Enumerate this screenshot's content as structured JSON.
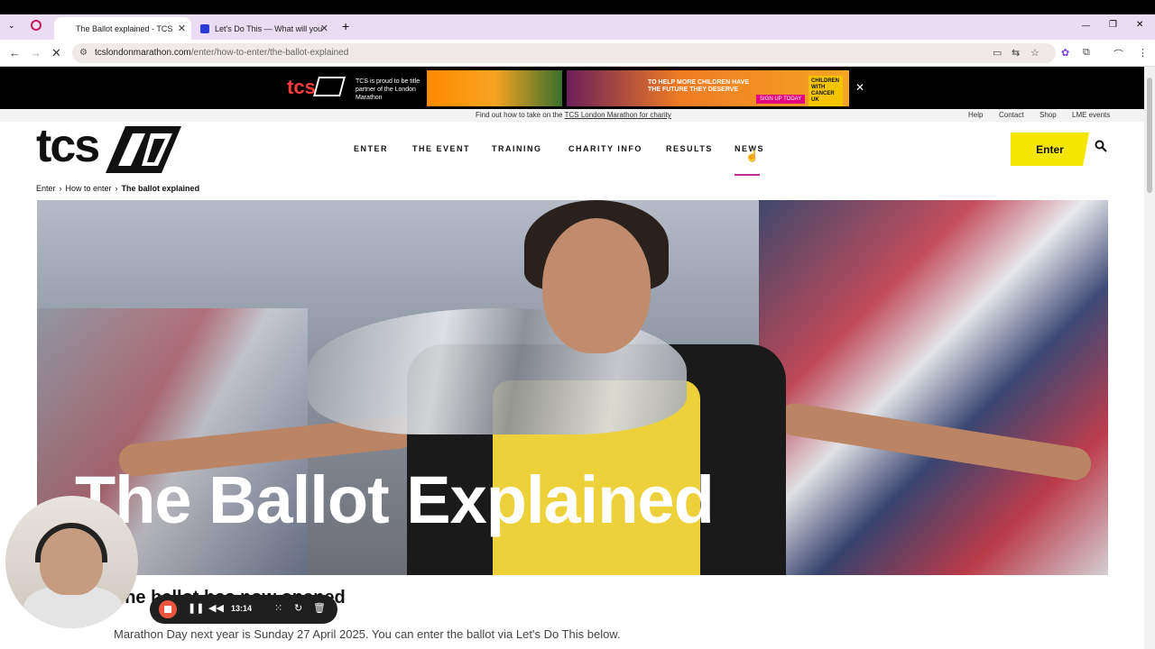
{
  "browser": {
    "tabs": [
      {
        "label": "The Ballot explained - TCS",
        "active": true
      },
      {
        "label": "Let's Do This — What will you",
        "active": false
      }
    ],
    "new_tab": "+",
    "url_host": "tcslondonmarathon.com",
    "url_path": "/enter/how-to-enter/the-ballot-explained",
    "window_controls": [
      "—",
      "❐",
      "✕"
    ]
  },
  "ad": {
    "partner_text": "TCS is proud to be title partner of the London Marathon",
    "children_caption": "TO HELP MORE CHILDREN HAVE THE FUTURE THEY DESERVE",
    "signup": "SIGN UP TODAY",
    "charity": "CHILDREN WITH CANCER UK",
    "close": "✕"
  },
  "utility": {
    "message_prefix": "Find out how to take on the",
    "message_link": "TCS London Marathon for charity",
    "links": [
      "Help",
      "Contact",
      "Shop",
      "LME events"
    ]
  },
  "site": {
    "logo": "tcs",
    "nav": [
      "ENTER",
      "THE EVENT",
      "TRAINING",
      "CHARITY INFO",
      "RESULTS",
      "NEWS"
    ],
    "enter_button": "Enter"
  },
  "breadcrumb": [
    "Enter",
    "How to enter",
    "The ballot explained"
  ],
  "hero": {
    "title": "The Ballot Explained"
  },
  "content": {
    "subheading": "The ballot has now opened",
    "body": "Marathon Day next year is Sunday 27 April 2025. You can enter the ballot via Let's Do This below."
  },
  "recorder": {
    "time": "13:14"
  }
}
